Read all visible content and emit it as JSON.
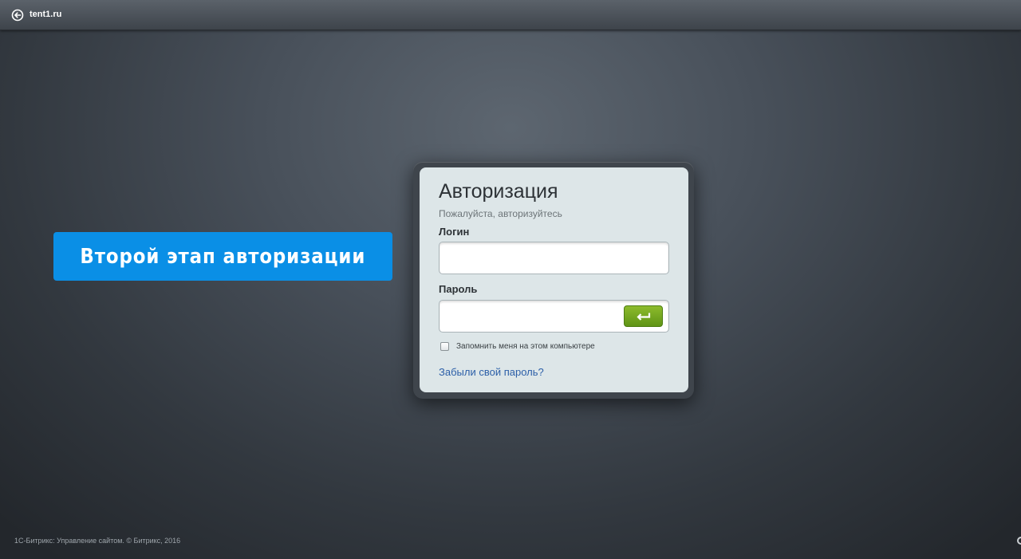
{
  "topbar": {
    "back_icon": "back-arrow-circle-icon",
    "site_name": "tent1.ru"
  },
  "callout": {
    "text": "Второй этап авторизации",
    "color": "#0a8fe6"
  },
  "auth": {
    "title": "Авторизация",
    "subtitle": "Пожалуйста, авторизуйтесь",
    "login_label": "Логин",
    "login_value": "",
    "password_label": "Пароль",
    "password_value": "",
    "submit_icon": "enter-arrow-icon",
    "submit_color": "#6fa41d",
    "remember_label": "Запомнить меня на этом компьютере",
    "remember_checked": false,
    "forgot_link": "Забыли свой пароль?"
  },
  "footer": {
    "copyright": "1С-Битрикс: Управление сайтом. © Битрикс, 2016"
  },
  "corner": {
    "icon": "partial-icon"
  }
}
